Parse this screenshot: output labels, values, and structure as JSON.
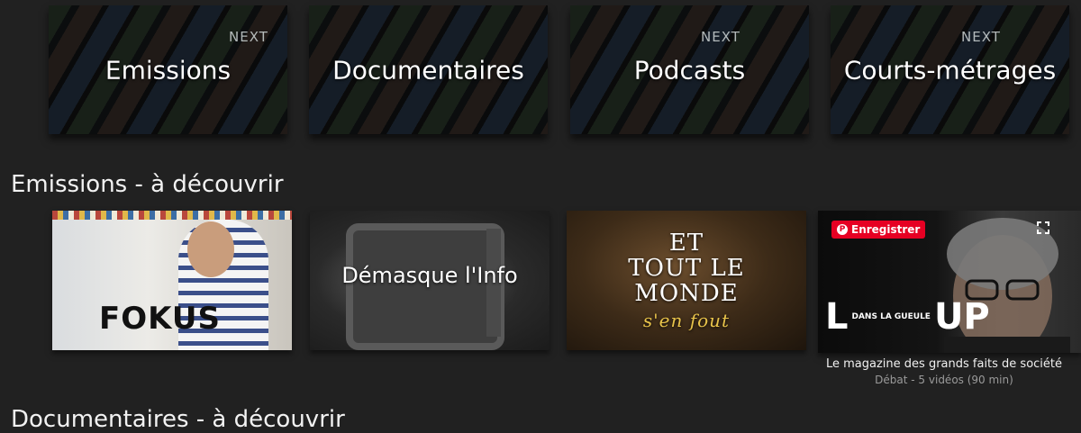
{
  "categories": [
    {
      "label": "Emissions",
      "next": "NEXT"
    },
    {
      "label": "Documentaires",
      "next": ""
    },
    {
      "label": "Podcasts",
      "next": "NEXT"
    },
    {
      "label": "Courts-métrages",
      "next": "NEXT"
    }
  ],
  "sections": {
    "emissions_title": "Emissions - à découvrir",
    "documentaires_title": "Documentaires - à découvrir"
  },
  "emissions": [
    {
      "logo": "FOKUS"
    },
    {
      "title": "Démasque l'Info"
    },
    {
      "title_lines": [
        "ET",
        "TOUT LE",
        "MONDE"
      ],
      "script": "s'en fout"
    },
    {
      "logo_main_left": "L",
      "logo_small": "DANS LA GUEULE",
      "logo_main_right": "UP",
      "pin_label": "Enregistrer",
      "caption": "Le magazine des grands faits de société",
      "meta": "Débat - 5 vidéos (90 min)"
    }
  ],
  "colors": {
    "background": "#212121",
    "pinterest": "#e60023",
    "meta_text": "#9a9a9a"
  }
}
